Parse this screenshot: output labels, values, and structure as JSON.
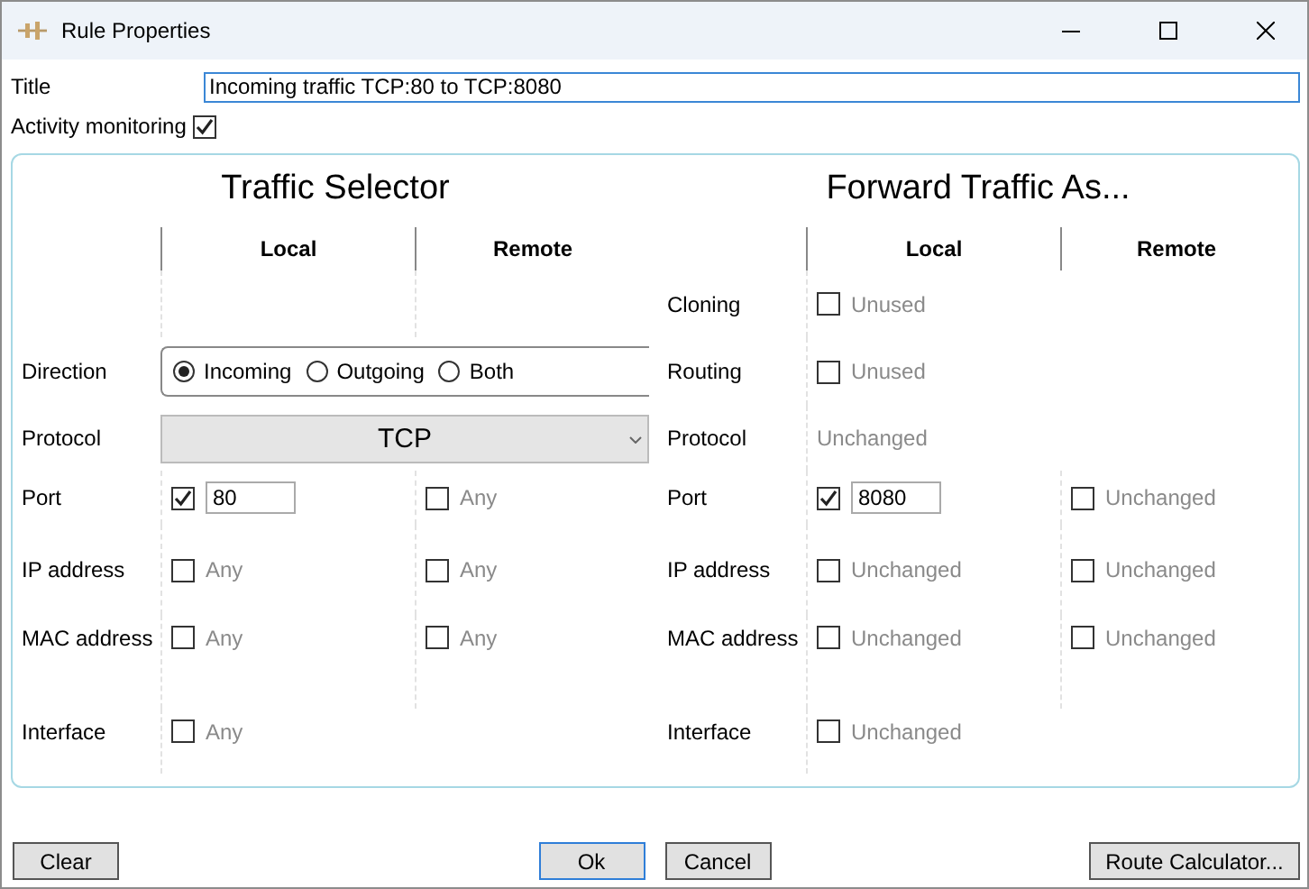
{
  "window": {
    "title": "Rule Properties"
  },
  "title_field": {
    "label": "Title",
    "value": "Incoming traffic TCP:80 to TCP:8080"
  },
  "activity_monitoring": {
    "label": "Activity monitoring",
    "checked": true
  },
  "panels": [
    {
      "heading": "Traffic Selector",
      "columns": [
        "Local",
        "Remote"
      ],
      "rows": [
        {
          "kind": "radio",
          "label": "Direction",
          "options": [
            {
              "label": "Incoming",
              "selected": true
            },
            {
              "label": "Outgoing",
              "selected": false
            },
            {
              "label": "Both",
              "selected": false
            }
          ]
        },
        {
          "kind": "dropdown",
          "label": "Protocol",
          "value": "TCP"
        },
        {
          "kind": "check",
          "label": "Port",
          "local": {
            "checked": true,
            "value": "80"
          },
          "remote": {
            "checked": false,
            "text": "Any"
          }
        },
        {
          "kind": "check",
          "label": "IP address",
          "local": {
            "checked": false,
            "text": "Any"
          },
          "remote": {
            "checked": false,
            "text": "Any"
          }
        },
        {
          "kind": "check",
          "label": "MAC address",
          "local": {
            "checked": false,
            "text": "Any"
          },
          "remote": {
            "checked": false,
            "text": "Any"
          }
        },
        {
          "kind": "check",
          "label": "Interface",
          "local": {
            "checked": false,
            "text": "Any"
          }
        }
      ]
    },
    {
      "heading": "Forward Traffic As...",
      "columns": [
        "Local",
        "Remote"
      ],
      "rows": [
        {
          "kind": "check",
          "label": "Cloning",
          "local": {
            "checked": false,
            "text": "Unused"
          }
        },
        {
          "kind": "check",
          "label": "Routing",
          "local": {
            "checked": false,
            "text": "Unused"
          }
        },
        {
          "kind": "text",
          "label": "Protocol",
          "value": "Unchanged"
        },
        {
          "kind": "check",
          "label": "Port",
          "local": {
            "checked": true,
            "value": "8080"
          },
          "remote": {
            "checked": false,
            "text": "Unchanged"
          }
        },
        {
          "kind": "check",
          "label": "IP address",
          "local": {
            "checked": false,
            "text": "Unchanged"
          },
          "remote": {
            "checked": false,
            "text": "Unchanged"
          }
        },
        {
          "kind": "check",
          "label": "MAC address",
          "local": {
            "checked": false,
            "text": "Unchanged"
          },
          "remote": {
            "checked": false,
            "text": "Unchanged"
          }
        },
        {
          "kind": "check",
          "label": "Interface",
          "local": {
            "checked": false,
            "text": "Unchanged"
          }
        }
      ]
    }
  ],
  "buttons": {
    "left": [
      "Clear"
    ],
    "center": [
      "Ok",
      "Cancel"
    ],
    "right": [
      "Route Calculator..."
    ]
  }
}
